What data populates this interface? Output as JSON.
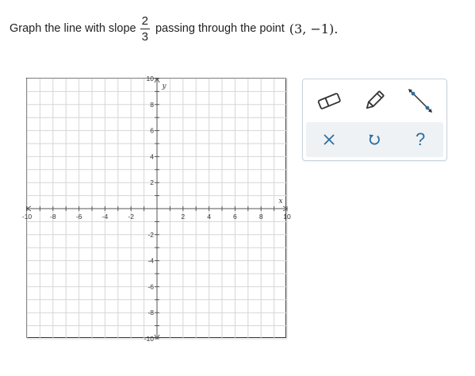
{
  "question": {
    "prefix": "Graph the line with slope",
    "slope_numerator": "2",
    "slope_denominator": "3",
    "middle": "passing through the point",
    "point": "(3, −1)."
  },
  "graph": {
    "x_axis_label": "x",
    "y_axis_label": "y",
    "x_range": [
      -10,
      10
    ],
    "y_range": [
      -10,
      10
    ],
    "grid_step": 1,
    "label_step": 2,
    "x_tick_labels": [
      "-10",
      "-8",
      "-6",
      "-4",
      "-2",
      "2",
      "4",
      "6",
      "8",
      "10"
    ],
    "y_tick_labels": [
      "10",
      "8",
      "6",
      "4",
      "2",
      "-2",
      "-4",
      "-6",
      "-8",
      "-10"
    ],
    "grid_color": "#d6d6d6",
    "axis_color": "#555555"
  },
  "tools": {
    "top_row": [
      {
        "name": "eraser-tool",
        "icon": "eraser-icon"
      },
      {
        "name": "pencil-tool",
        "icon": "pencil-icon"
      },
      {
        "name": "line-tool",
        "icon": "line-tool-icon"
      }
    ],
    "bottom_row": [
      {
        "name": "clear-button",
        "icon": "close-icon"
      },
      {
        "name": "undo-button",
        "icon": "undo-icon"
      },
      {
        "name": "help-button",
        "icon": "help-icon",
        "glyph": "?"
      }
    ],
    "icon_color": "#2f6e9e",
    "dark_icon_color": "#333333"
  }
}
